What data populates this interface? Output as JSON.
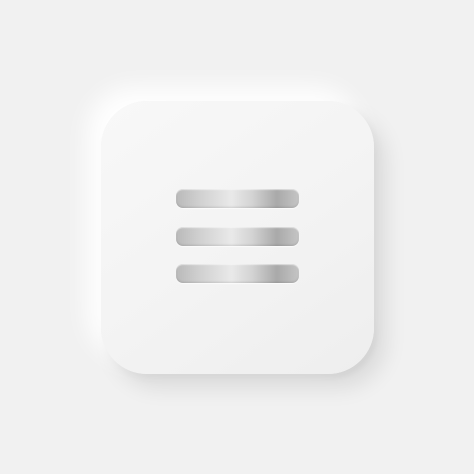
{
  "app": {
    "title": ""
  },
  "menu_button": {
    "icon": "hamburger-menu-icon",
    "bars": 3
  },
  "colors": {
    "background": "#f1f1f1",
    "button_surface": "#f5f5f5",
    "icon_metal_light": "#e9e9e9",
    "icon_metal_dark": "#a9a9a9"
  }
}
